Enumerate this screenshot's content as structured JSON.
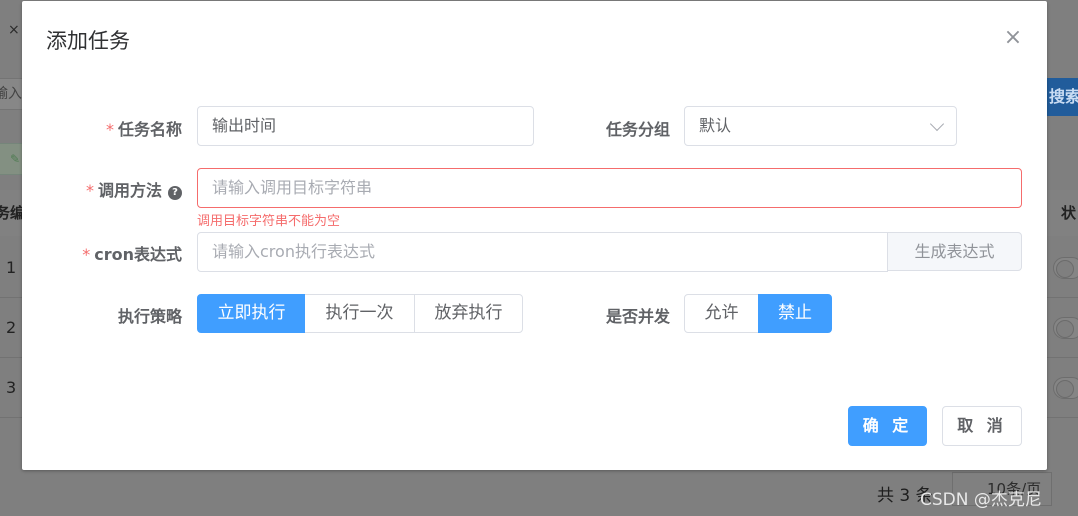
{
  "background": {
    "tab_close": "×",
    "search_input_fragment": "输入",
    "search_button_fragment": "搜索",
    "table_header_left_fragment": "务编",
    "table_header_right_fragment": "状",
    "row_numbers": [
      "1",
      "2",
      "3"
    ],
    "pagination_total": "共 3 条",
    "pagination_page_size": "10条/页"
  },
  "watermark": "CSDN @杰克尼",
  "dialog": {
    "title": "添加任务",
    "close_icon": "close-icon",
    "form": {
      "task_name": {
        "label": "任务名称",
        "required": "*",
        "value": "输出时间"
      },
      "task_group": {
        "label": "任务分组",
        "value": "默认"
      },
      "invoke_target": {
        "label": "调用方法",
        "required": "*",
        "help_glyph": "?",
        "placeholder": "请输入调用目标字符串",
        "error": "调用目标字符串不能为空"
      },
      "cron": {
        "label": "cron表达式",
        "required": "*",
        "placeholder": "请输入cron执行表达式",
        "append_button": "生成表达式"
      },
      "misfire_policy": {
        "label": "执行策略",
        "options": [
          "立即执行",
          "执行一次",
          "放弃执行"
        ],
        "selected": "立即执行"
      },
      "concurrent": {
        "label": "是否并发",
        "options": [
          "允许",
          "禁止"
        ],
        "selected": "禁止"
      }
    },
    "footer": {
      "confirm": "确 定",
      "cancel": "取 消"
    }
  },
  "colors": {
    "primary": "#409eff",
    "danger": "#f56c6c",
    "overlay": "#7f7f7f"
  }
}
